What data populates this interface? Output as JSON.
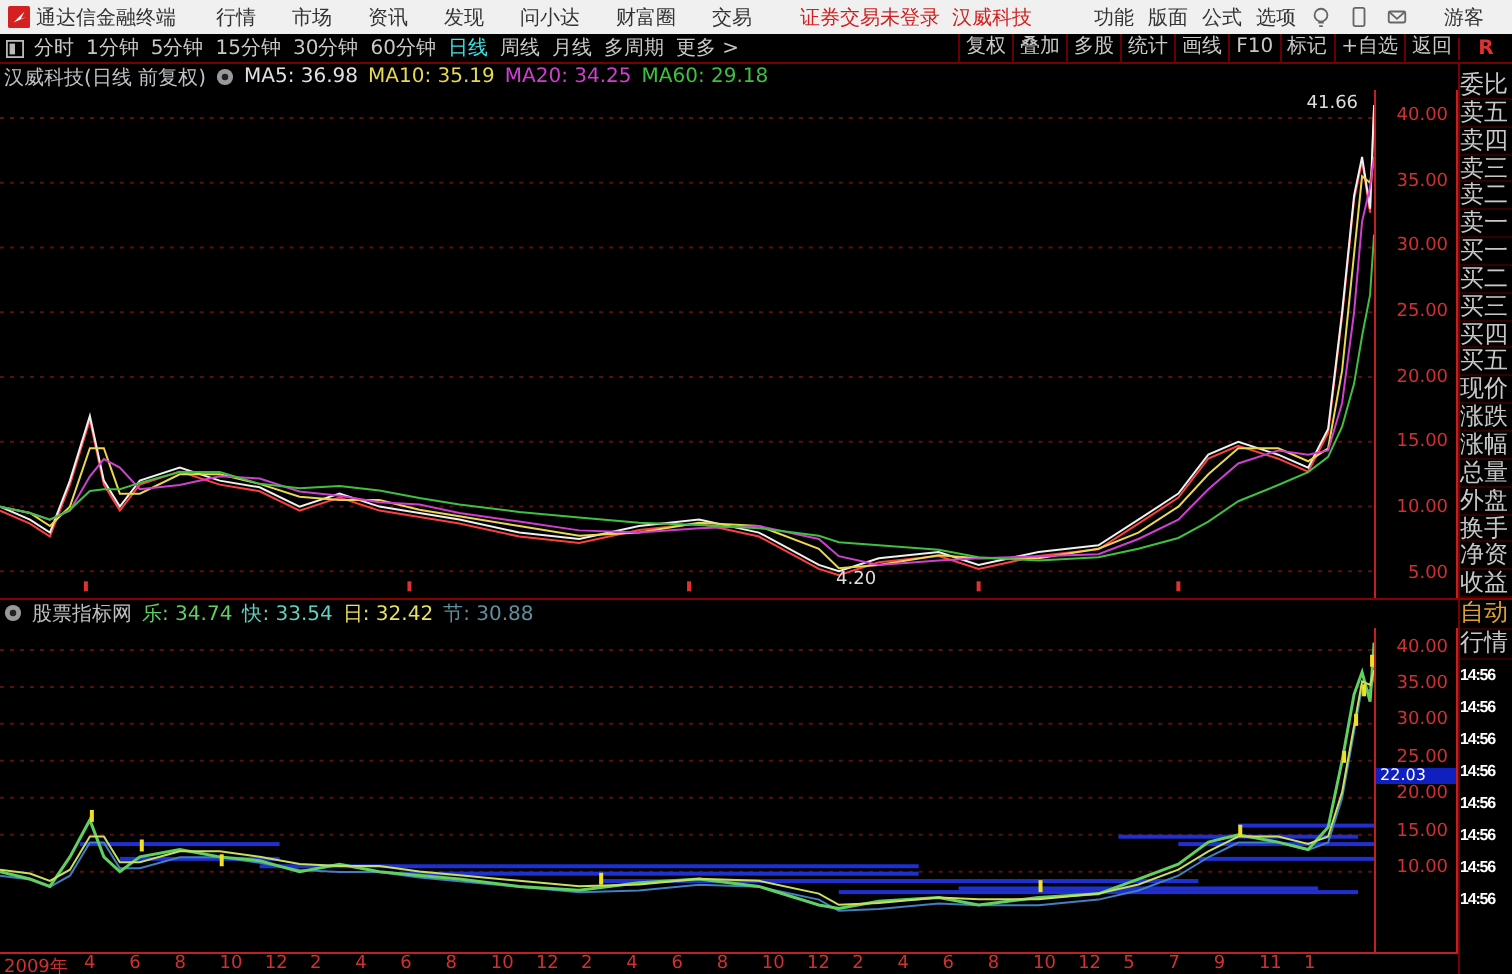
{
  "app": {
    "title": "通达信金融终端",
    "menus": [
      "行情",
      "市场",
      "资讯",
      "发现",
      "问小达",
      "财富圈",
      "交易"
    ],
    "login_status": "证券交易未登录",
    "stock_link": "汉威科技",
    "right_menus": [
      "功能",
      "版面",
      "公式",
      "选项"
    ],
    "user": "游客"
  },
  "period_bar": {
    "periods": [
      {
        "label": "分时",
        "selected": false
      },
      {
        "label": "1分钟",
        "selected": false
      },
      {
        "label": "5分钟",
        "selected": false
      },
      {
        "label": "15分钟",
        "selected": false
      },
      {
        "label": "30分钟",
        "selected": false
      },
      {
        "label": "60分钟",
        "selected": false
      },
      {
        "label": "日线",
        "selected": true
      },
      {
        "label": "周线",
        "selected": false
      },
      {
        "label": "月线",
        "selected": false
      },
      {
        "label": "多周期",
        "selected": false
      }
    ],
    "more": "更多 >",
    "tools": [
      "复权",
      "叠加",
      "多股",
      "统计",
      "画线",
      "F10",
      "标记",
      "+自选",
      "返回"
    ],
    "right_tab": "R"
  },
  "main_chart": {
    "title": "汉威科技(日线 前复权)",
    "ma": [
      {
        "label": "MA5: 36.98",
        "color": "#e0e0e0"
      },
      {
        "label": "MA10: 35.19",
        "color": "#e8d850"
      },
      {
        "label": "MA20: 34.25",
        "color": "#d040d0"
      },
      {
        "label": "MA60: 29.18",
        "color": "#40c040"
      }
    ],
    "price_axis": [
      "40.00",
      "35.00",
      "30.00",
      "25.00",
      "20.00",
      "15.00",
      "10.00",
      "5.00"
    ],
    "high_label": "41.66",
    "low_label": "4.20"
  },
  "indicator": {
    "title": "股票指标网",
    "values": [
      {
        "label": "乐: 34.74",
        "color": "#60d060"
      },
      {
        "label": "快: 33.54",
        "color": "#60d0c0"
      },
      {
        "label": "日: 32.42",
        "color": "#e8e060"
      },
      {
        "label": "节: 30.88",
        "color": "#6090a0"
      }
    ],
    "axis": [
      "40.00",
      "35.00",
      "30.00",
      "25.00",
      "20.00",
      "15.00",
      "10.00"
    ],
    "marker": "22.03"
  },
  "date_axis": [
    "2009年",
    "4",
    "6",
    "8",
    "10",
    "12",
    "2",
    "4",
    "6",
    "8",
    "10",
    "12",
    "2",
    "4",
    "6",
    "8",
    "10",
    "12",
    "2",
    "4",
    "6",
    "8",
    "10",
    "12",
    "5",
    "7",
    "9",
    "11",
    "1"
  ],
  "quote_panel": {
    "labels": [
      "委比",
      "卖五",
      "卖四",
      "卖三",
      "卖二",
      "卖一",
      "买一",
      "买二",
      "买三",
      "买四",
      "买五",
      "现价",
      "涨跌",
      "涨幅",
      "总量",
      "外盘",
      "换手",
      "净资",
      "收益"
    ]
  },
  "bottom_panel": {
    "labels": [
      {
        "text": "自动",
        "kind": "mode"
      },
      {
        "text": "行情",
        "kind": "plain"
      }
    ],
    "times": [
      "14:56",
      "14:56",
      "14:56",
      "14:56",
      "14:56",
      "14:56",
      "14:56",
      "14:56"
    ]
  }
}
